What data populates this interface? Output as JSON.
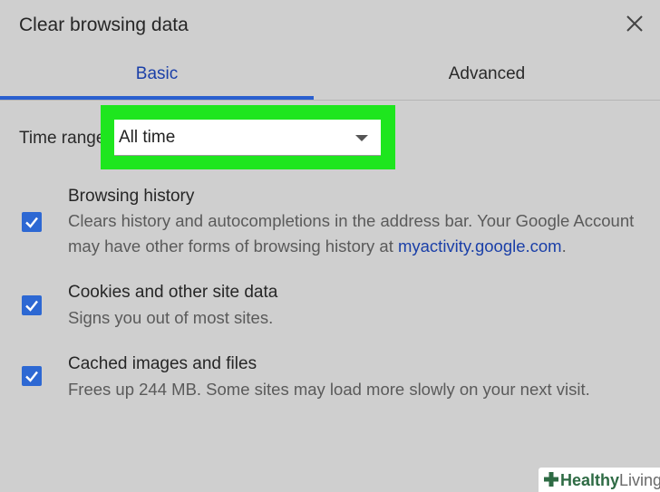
{
  "dialog": {
    "title": "Clear browsing data",
    "close_icon": "close-icon"
  },
  "tabs": [
    {
      "label": "Basic",
      "active": true
    },
    {
      "label": "Advanced",
      "active": false
    }
  ],
  "time_range": {
    "label": "Time range",
    "value": "All time",
    "dropdown_icon": "triangle-down-icon"
  },
  "options": [
    {
      "title": "Browsing history",
      "description_prefix": "Clears history and autocompletions in the address bar. Your Google Account may have other forms of browsing history at ",
      "link": "myactivity.google.com",
      "description_suffix": ".",
      "checked": true
    },
    {
      "title": "Cookies and other site data",
      "description": "Signs you out of most sites.",
      "checked": true
    },
    {
      "title": "Cached images and files",
      "description": "Frees up 244 MB. Some sites may load more slowly on your next visit.",
      "checked": true
    }
  ],
  "watermark": {
    "part1": "Healthy",
    "part2": "Living"
  },
  "colors": {
    "accent": "#2d68d3",
    "highlight": "#1ee61e",
    "background": "#cfcfcf"
  }
}
